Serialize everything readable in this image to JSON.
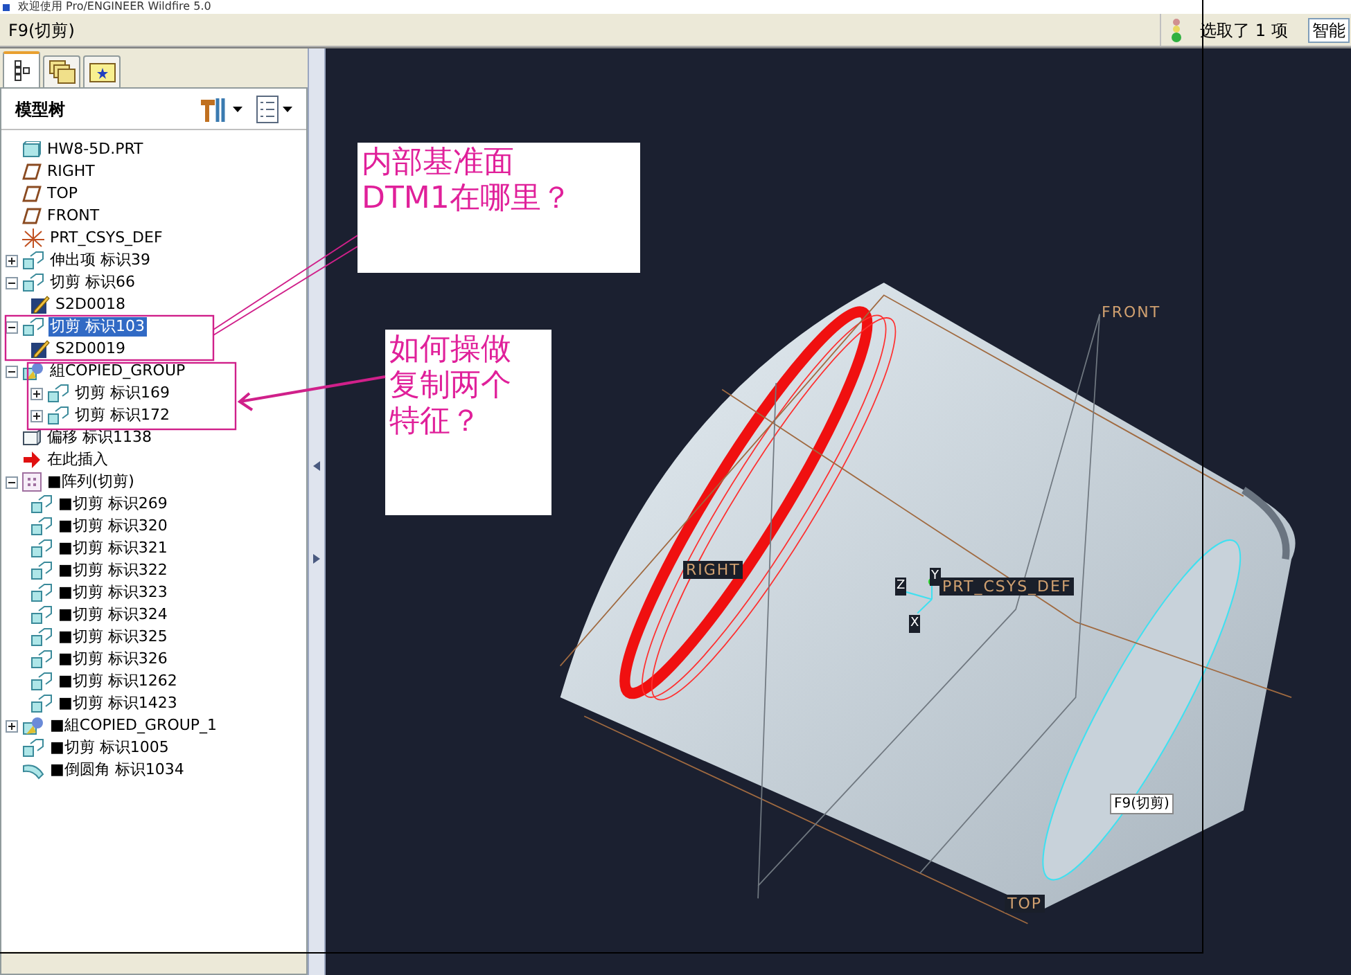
{
  "window": {
    "title": "欢迎使用 Pro/ENGINEER Wildfire 5.0"
  },
  "message_bar": {
    "text": "F9(切剪)",
    "status": "选取了 1 项",
    "filter": "智能"
  },
  "panel_tabs": [
    {
      "kind": "tree",
      "selected": true
    },
    {
      "kind": "layers",
      "selected": false
    },
    {
      "kind": "favorites",
      "selected": false
    }
  ],
  "model_tree": {
    "title": "模型树",
    "items": [
      {
        "kind": "part",
        "label": "HW8-5D.PRT",
        "selected": false
      },
      {
        "kind": "plane",
        "label": "RIGHT",
        "selected": false
      },
      {
        "kind": "plane",
        "label": "TOP",
        "selected": false
      },
      {
        "kind": "plane",
        "label": "FRONT",
        "selected": false
      },
      {
        "kind": "csys",
        "label": "PRT_CSYS_DEF",
        "selected": false
      },
      {
        "kind": "cut",
        "label": "伸出项 标识39",
        "selected": false,
        "expanded": false
      },
      {
        "kind": "cut",
        "label": "切剪 标识66",
        "selected": false,
        "expanded": true,
        "children": [
          {
            "kind": "sketch",
            "label": "S2D0018",
            "selected": false
          }
        ]
      },
      {
        "kind": "cut",
        "label": "切剪 标识103",
        "selected": true,
        "expanded": true,
        "children": [
          {
            "kind": "sketch",
            "label": "S2D0019",
            "selected": false
          }
        ]
      },
      {
        "kind": "group",
        "label": "組COPIED_GROUP",
        "selected": false,
        "expanded": true,
        "children": [
          {
            "kind": "cut",
            "label": "切剪 标识169",
            "selected": false,
            "expanded": false
          },
          {
            "kind": "cut",
            "label": "切剪 标识172",
            "selected": false,
            "expanded": false
          }
        ]
      },
      {
        "kind": "offset",
        "label": "偏移 标识1138",
        "selected": false
      },
      {
        "kind": "insert",
        "label": "在此插入",
        "selected": false
      },
      {
        "kind": "pattern",
        "label": "■阵列(切剪)",
        "selected": false,
        "expanded": true,
        "children": [
          {
            "kind": "cut",
            "label": "■切剪 标识269",
            "selected": false
          },
          {
            "kind": "cut",
            "label": "■切剪 标识320",
            "selected": false
          },
          {
            "kind": "cut",
            "label": "■切剪 标识321",
            "selected": false
          },
          {
            "kind": "cut",
            "label": "■切剪 标识322",
            "selected": false
          },
          {
            "kind": "cut",
            "label": "■切剪 标识323",
            "selected": false
          },
          {
            "kind": "cut",
            "label": "■切剪 标识324",
            "selected": false
          },
          {
            "kind": "cut",
            "label": "■切剪 标识325",
            "selected": false
          },
          {
            "kind": "cut",
            "label": "■切剪 标识326",
            "selected": false
          },
          {
            "kind": "cut",
            "label": "■切剪 标识1262",
            "selected": false
          },
          {
            "kind": "cut",
            "label": "■切剪 标识1423",
            "selected": false
          }
        ]
      },
      {
        "kind": "group",
        "label": "■組COPIED_GROUP_1",
        "selected": false,
        "expanded": false
      },
      {
        "kind": "cut",
        "label": "■切剪 标识1005",
        "selected": false
      },
      {
        "kind": "round",
        "label": "■倒圆角 标识1034",
        "selected": false
      }
    ]
  },
  "viewport": {
    "labels": [
      {
        "kind": "datum",
        "text": "FRONT"
      },
      {
        "kind": "datum",
        "text": "RIGHT"
      },
      {
        "kind": "datum",
        "text": "PRT_CSYS_DEF"
      },
      {
        "kind": "datum",
        "text": "TOP"
      },
      {
        "kind": "tip",
        "text": "F9(切剪)"
      },
      {
        "kind": "axis",
        "text": "Z"
      },
      {
        "kind": "axis",
        "text": "Y"
      },
      {
        "kind": "axis",
        "text": "X"
      }
    ]
  },
  "callouts": [
    {
      "lines": [
        "内部基准面",
        "DTM1在哪里？"
      ]
    },
    {
      "lines": [
        "如何操做",
        "复制两个",
        "特征？"
      ]
    }
  ]
}
